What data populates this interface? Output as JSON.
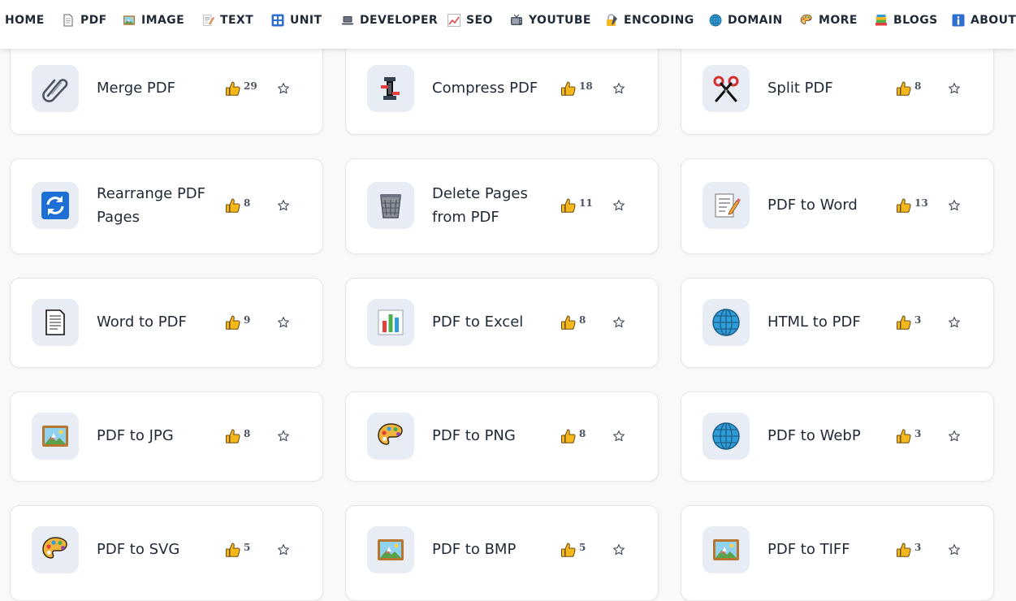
{
  "nav": {
    "items": [
      {
        "label": "HOME",
        "icon": ""
      },
      {
        "label": "PDF",
        "icon": "document-icon"
      },
      {
        "label": "IMAGE",
        "icon": "framed-picture-icon"
      },
      {
        "label": "TEXT",
        "icon": "memo-icon"
      },
      {
        "label": "UNIT",
        "icon": "grid-icon"
      },
      {
        "label": "DEVELOPER",
        "icon": "laptop-icon"
      },
      {
        "label": "SEO",
        "icon": "chart-increasing-icon"
      },
      {
        "label": "YOUTUBE",
        "icon": "television-icon"
      },
      {
        "label": "ENCODING",
        "icon": "locked-with-pen-icon"
      },
      {
        "label": "DOMAIN",
        "icon": "globe-icon"
      },
      {
        "label": "MORE",
        "icon": "palette-icon"
      },
      {
        "label": "BLOGS",
        "icon": "books-icon"
      },
      {
        "label": "ABOUT",
        "icon": "information-icon"
      }
    ]
  },
  "tools": [
    {
      "title": "Merge PDF",
      "likes": "29",
      "icon": "paperclips-icon"
    },
    {
      "title": "Compress PDF",
      "likes": "18",
      "icon": "clamp-icon"
    },
    {
      "title": "Split PDF",
      "likes": "8",
      "icon": "scissors-icon"
    },
    {
      "title": "Rearrange PDF Pages",
      "likes": "8",
      "icon": "arrows-cycle-icon"
    },
    {
      "title": "Delete Pages from PDF",
      "likes": "11",
      "icon": "wastebasket-icon"
    },
    {
      "title": "PDF to Word",
      "likes": "13",
      "icon": "memo-icon"
    },
    {
      "title": "Word to PDF",
      "likes": "9",
      "icon": "page-icon"
    },
    {
      "title": "PDF to Excel",
      "likes": "8",
      "icon": "bar-chart-icon"
    },
    {
      "title": "HTML to PDF",
      "likes": "3",
      "icon": "globe-icon"
    },
    {
      "title": "PDF to JPG",
      "likes": "8",
      "icon": "framed-picture-icon"
    },
    {
      "title": "PDF to PNG",
      "likes": "8",
      "icon": "palette-icon"
    },
    {
      "title": "PDF to WebP",
      "likes": "3",
      "icon": "globe-icon"
    },
    {
      "title": "PDF to SVG",
      "likes": "5",
      "icon": "palette-icon"
    },
    {
      "title": "PDF to BMP",
      "likes": "5",
      "icon": "framed-picture-icon"
    },
    {
      "title": "PDF to TIFF",
      "likes": "3",
      "icon": "framed-picture-icon"
    }
  ],
  "colors": {
    "accent": "#f4b81c",
    "text": "#1f2937",
    "tile": "#e8edf5",
    "border": "#e5e7eb"
  }
}
